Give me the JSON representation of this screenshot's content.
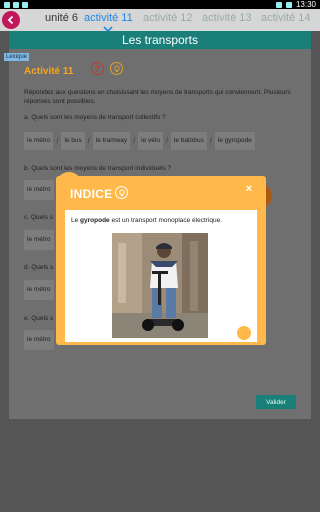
{
  "status_bar": {
    "time": "13:30"
  },
  "header": {
    "unit_label": "unité 6",
    "tabs": [
      {
        "label": "activité 11",
        "active": true
      },
      {
        "label": "activité 12",
        "active": false
      },
      {
        "label": "activité 13",
        "active": false
      },
      {
        "label": "activité 14",
        "active": false
      }
    ]
  },
  "page": {
    "title": "Les transports",
    "lexique_label": "Lexique",
    "activity_title": "Activité 11",
    "help_label": "?",
    "instructions": "Répondez aux questions en choisissant les moyens de transports qui conviennent. Plusieurs réponses sont possibles.",
    "questions": {
      "a": "a. Quels sont les moyens de transport collectifs ?",
      "b": "b. Quels sont les moyens de transport individuels ?",
      "c": "c. Quels s",
      "d": "d. Quels s",
      "e": "e. Quels s"
    },
    "options": [
      "le métro",
      "le bus",
      "le tramway",
      "le vélo",
      "le batobus",
      "le gyropode"
    ],
    "separator": "/",
    "blank_placeholder": "le métro",
    "validate_label": "Valider"
  },
  "modal": {
    "title": "INDICE",
    "close_label": "×",
    "text_before": "Le ",
    "text_bold": "gyropode",
    "text_after": " est un transport monoplace électrique."
  },
  "colors": {
    "title_band": "#1b7f79",
    "modal": "#ffb84a",
    "active_tab": "#1e88e5",
    "activity_title": "#f5a623",
    "back_button": "#c2185b"
  },
  "icons": [
    "back-arrow-icon",
    "chevron-down-icon",
    "lightbulb-icon",
    "close-icon"
  ]
}
